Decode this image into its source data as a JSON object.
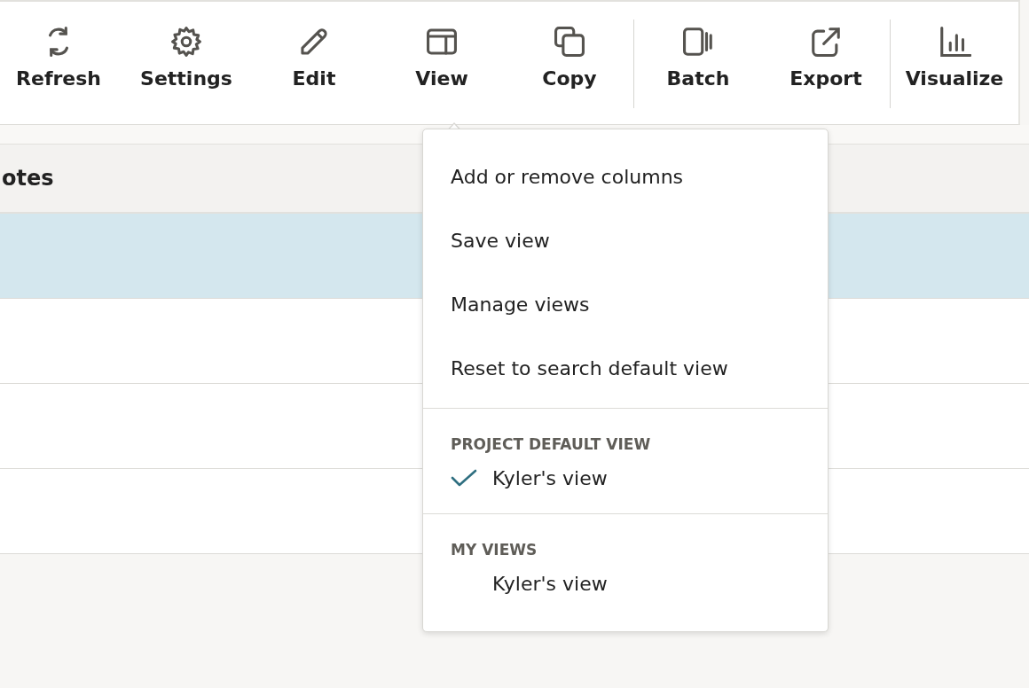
{
  "toolbar": {
    "groups": [
      {
        "buttons": [
          {
            "label": "Refresh",
            "kind": "refresh",
            "expanded": false
          },
          {
            "label": "Settings",
            "kind": "gear",
            "expanded": false
          },
          {
            "label": "Edit",
            "kind": "pencil",
            "expanded": false
          },
          {
            "label": "View",
            "kind": "layout",
            "expanded": true
          },
          {
            "label": "Copy",
            "kind": "copy",
            "expanded": false
          }
        ]
      },
      {
        "buttons": [
          {
            "label": "Batch",
            "kind": "batch",
            "expanded": false
          },
          {
            "label": "Export",
            "kind": "export",
            "expanded": false
          }
        ]
      },
      {
        "buttons": [
          {
            "label": "Visualize",
            "kind": "chart",
            "expanded": false
          }
        ]
      }
    ]
  },
  "table": {
    "columns": [
      "otes"
    ],
    "rows": [
      {
        "selected": true
      },
      {
        "selected": false
      },
      {
        "selected": false
      },
      {
        "selected": false
      }
    ]
  },
  "view_menu": {
    "items": [
      {
        "kind": "action",
        "label": "Add or remove columns"
      },
      {
        "kind": "action",
        "label": "Save view"
      },
      {
        "kind": "action",
        "label": "Manage views"
      },
      {
        "kind": "action",
        "label": "Reset to search default view"
      },
      {
        "kind": "divider"
      },
      {
        "kind": "header",
        "label": "PROJECT DEFAULT VIEW"
      },
      {
        "kind": "option",
        "label": "Kyler's view",
        "checked": true
      },
      {
        "kind": "divider"
      },
      {
        "kind": "header",
        "label": "MY VIEWS"
      },
      {
        "kind": "option",
        "label": "Kyler's view",
        "checked": false
      }
    ]
  }
}
